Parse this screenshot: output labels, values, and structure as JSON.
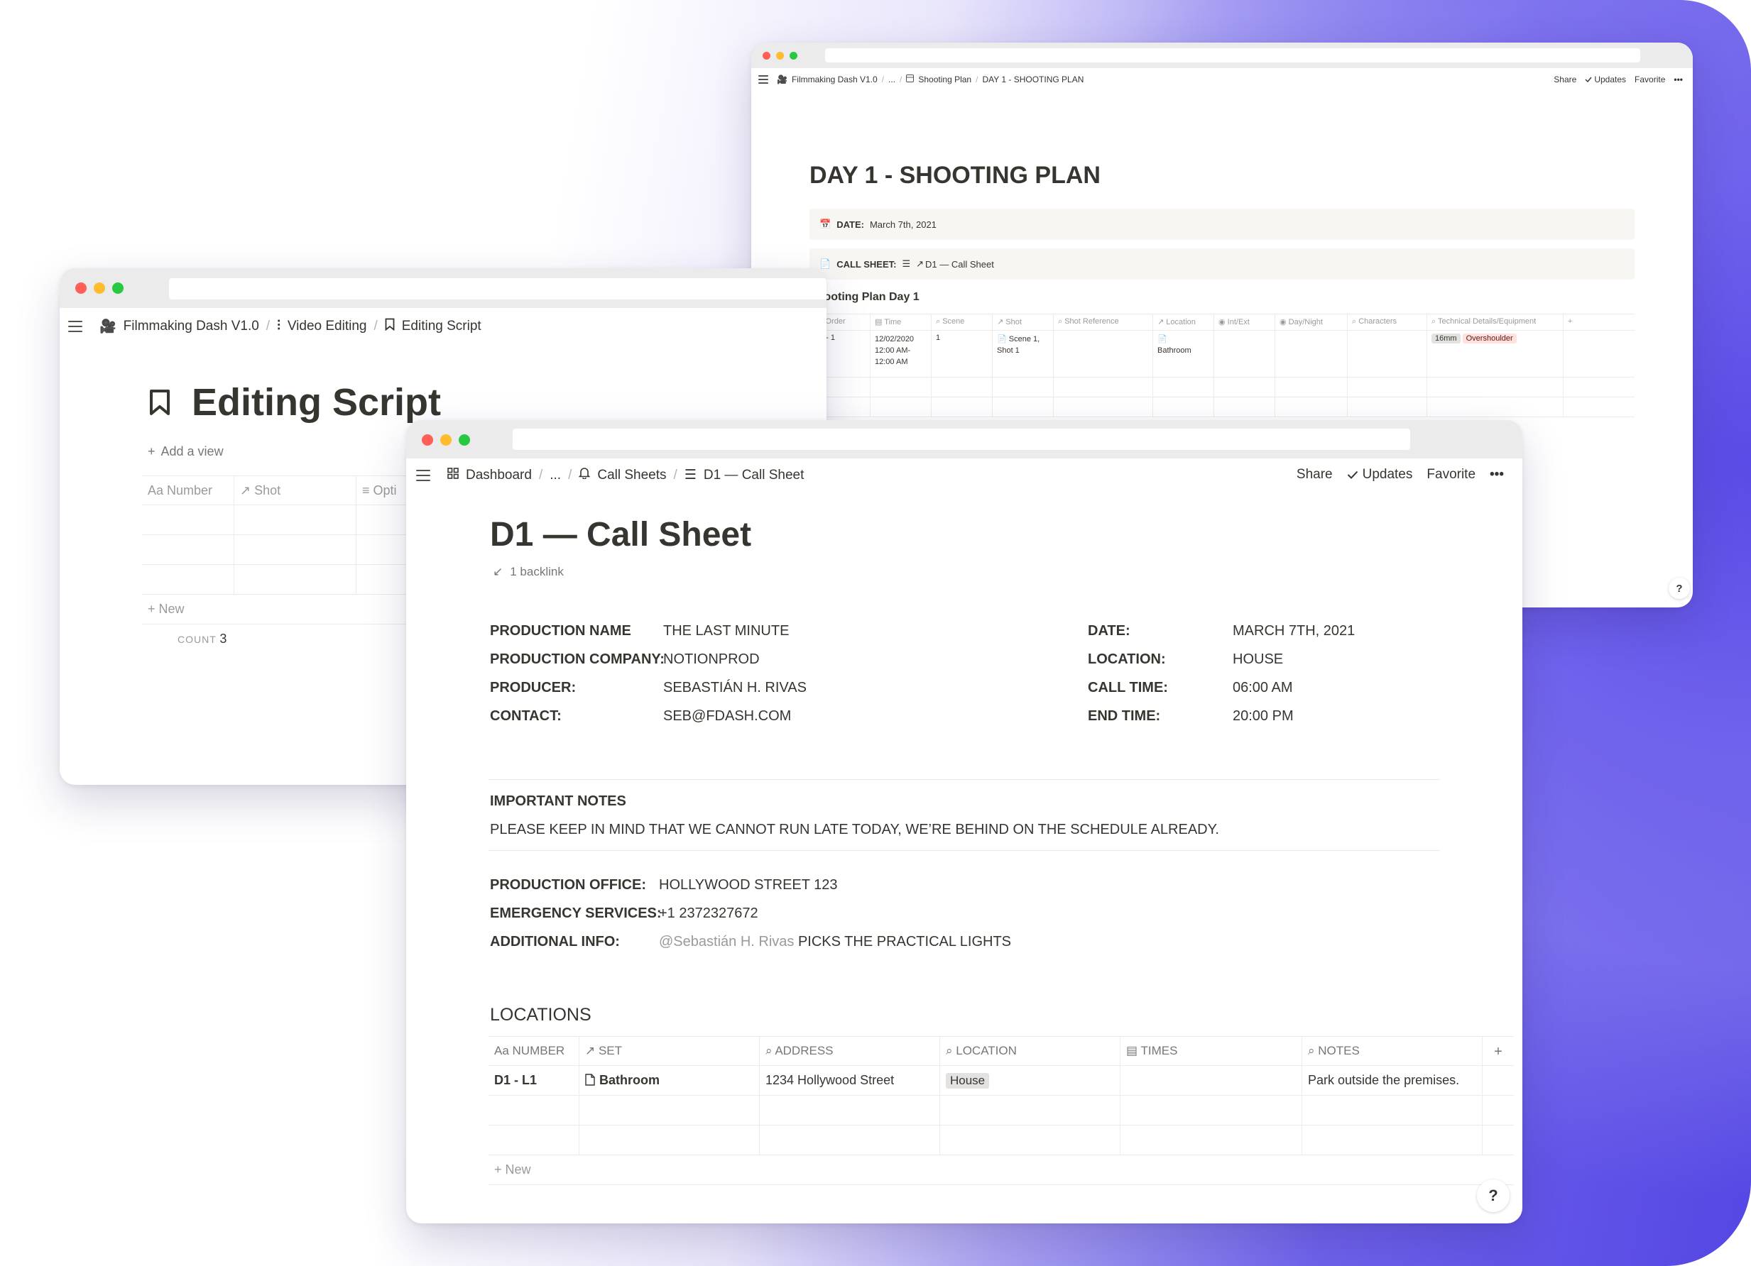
{
  "plan_window": {
    "breadcrumb": [
      "Filmmaking Dash V1.0",
      "...",
      "Shooting Plan",
      "DAY 1 - SHOOTING PLAN"
    ],
    "actions": {
      "share": "Share",
      "updates": "Updates",
      "favorite": "Favorite",
      "more": "•••"
    },
    "title": "DAY 1 - SHOOTING PLAN",
    "date_label": "DATE:",
    "date_value": "March 7th, 2021",
    "callsheet_label": "CALL SHEET:",
    "callsheet_value": "D1 — Call Sheet",
    "table_title": "Shooting Plan Day 1",
    "columns": [
      "Order",
      "Time",
      "Scene",
      "Shot",
      "Shot Reference",
      "Location",
      "Int/Ext",
      "Day/Night",
      "Characters",
      "Technical Details/Equipment",
      "+"
    ],
    "row": {
      "order": "D1 - 1",
      "time": "12/02/2020 12:00 AM-12:00 AM",
      "scene": "1",
      "shot": "Scene 1, Shot 1",
      "location": "Bathroom",
      "tags": [
        "16mm",
        "Overshoulder"
      ]
    },
    "help": "?"
  },
  "edit_window": {
    "breadcrumb": [
      "Filmmaking Dash V1.0",
      "Video Editing",
      "Editing Script"
    ],
    "title": "Editing Script",
    "add_view": "Add a view",
    "columns": [
      "Number",
      "Shot",
      "Opti"
    ],
    "new_label": "New",
    "count_label": "COUNT",
    "count_value": "3"
  },
  "call_window": {
    "breadcrumb": [
      "Dashboard",
      "...",
      "Call Sheets",
      "D1 — Call Sheet"
    ],
    "actions": {
      "share": "Share",
      "updates": "Updates",
      "favorite": "Favorite",
      "more": "•••"
    },
    "title": "D1 — Call Sheet",
    "backlink": "1 backlink",
    "left_fields": [
      {
        "label": "PRODUCTION NAME",
        "value": "THE LAST MINUTE"
      },
      {
        "label": "PRODUCTION COMPANY:",
        "value": "NOTIONPROD"
      },
      {
        "label": "PRODUCER:",
        "value": "SEBASTIÁN H. RIVAS"
      },
      {
        "label": "CONTACT:",
        "value": "SEB@FDASH.COM"
      }
    ],
    "right_fields": [
      {
        "label": "DATE:",
        "value": "MARCH 7TH, 2021"
      },
      {
        "label": "LOCATION:",
        "value": "HOUSE"
      },
      {
        "label": "CALL TIME:",
        "value": "06:00 AM"
      },
      {
        "label": "END TIME:",
        "value": "20:00 PM"
      }
    ],
    "notes_heading": "IMPORTANT NOTES",
    "notes_text": "PLEASE KEEP IN MIND THAT WE CANNOT RUN LATE TODAY, WE’RE BEHIND ON THE SCHEDULE ALREADY.",
    "office_fields": [
      {
        "label": "PRODUCTION OFFICE:",
        "value": "HOLLYWOOD STREET 123"
      },
      {
        "label": "EMERGENCY SERVICES:",
        "value": "+1 2372327672"
      }
    ],
    "additional_label": "ADDITIONAL INFO:",
    "additional_mention": "@Sebastián H. Rivas",
    "additional_text": "PICKS THE PRACTICAL LIGHTS",
    "locations_heading": "LOCATIONS",
    "loc_columns": [
      "NUMBER",
      "SET",
      "ADDRESS",
      "LOCATION",
      "TIMES",
      "NOTES"
    ],
    "loc_row": {
      "number": "D1 - L1",
      "set": "Bathroom",
      "address": "1234 Hollywood Street",
      "location": "House",
      "times": "",
      "notes": "Park outside the premises."
    },
    "new_label": "New",
    "help": "?"
  }
}
